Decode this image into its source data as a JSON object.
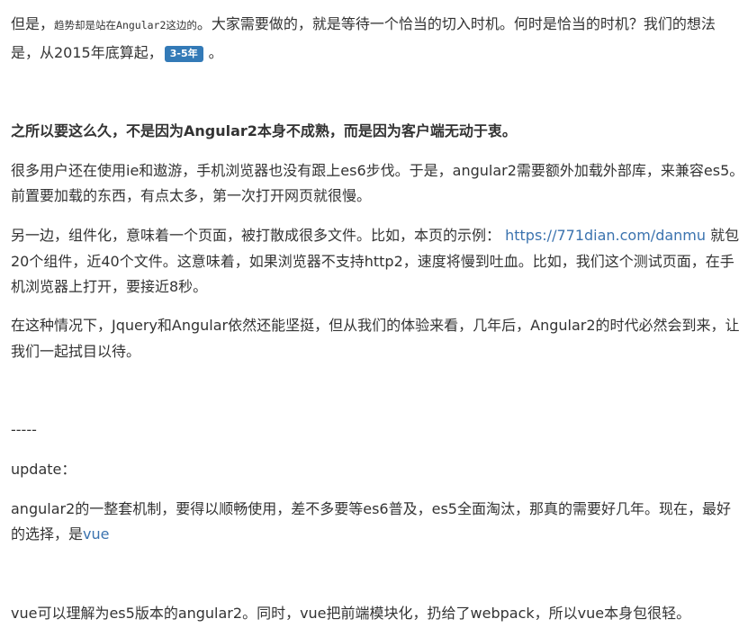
{
  "p1": {
    "pre": "但是，",
    "mono": "趋势却是站在Angular2这边的",
    "post": "。大家需要做的，就是等待一个恰当的切入时机。何时是恰当的时机？我们的想法",
    "line2_pre": "是，从2015年底算起，",
    "badge": "3-5年",
    "line2_post": "。"
  },
  "heading": "之所以要这么久，不是因为Angular2本身不成熟，而是因为客户端无动于衷。",
  "p2": {
    "line1": "很多用户还在使用ie和遨游，手机浏览器也没有跟上es6步伐。于是，angular2需要额外加载外部库，来兼容es5。",
    "line2": "前置要加载的东西，有点太多，第一次打开网页就很慢。"
  },
  "p3": {
    "line1_pre": "另一边，组件化，意味着一个页面，被打散成很多文件。比如，本页的示例：",
    "link": "https://771dian.com/danmu",
    "line1_post": "就包含",
    "line2": "20个组件，近40个文件。这意味着，如果浏览器不支持http2，速度将慢到吐血。比如，我们这个测试页面，在手",
    "line3": "机浏览器上打开，要接近8秒。"
  },
  "p4": {
    "line1": "在这种情况下，Jquery和Angular依然还能坚挺，但从我们的体验来看，几年后，Angular2的时代必然会到来，让",
    "line2": "我们一起拭目以待。"
  },
  "separator": "-----",
  "update": "update：",
  "p5": {
    "line1": "angular2的一整套机制，要得以顺畅使用，差不多要等es6普及，es5全面淘汰，那真的需要好几年。现在，最好",
    "line2_pre": "的选择，是",
    "link": "vue"
  },
  "p6": {
    "line1": "vue可以理解为es5版本的angular2。同时，vue把前端模块化，扔给了webpack，所以vue本身包很轻。"
  },
  "colors": {
    "text": "#333333",
    "link": "#3b73af",
    "badge_bg": "#337ab7",
    "badge_text": "#ffffff"
  }
}
